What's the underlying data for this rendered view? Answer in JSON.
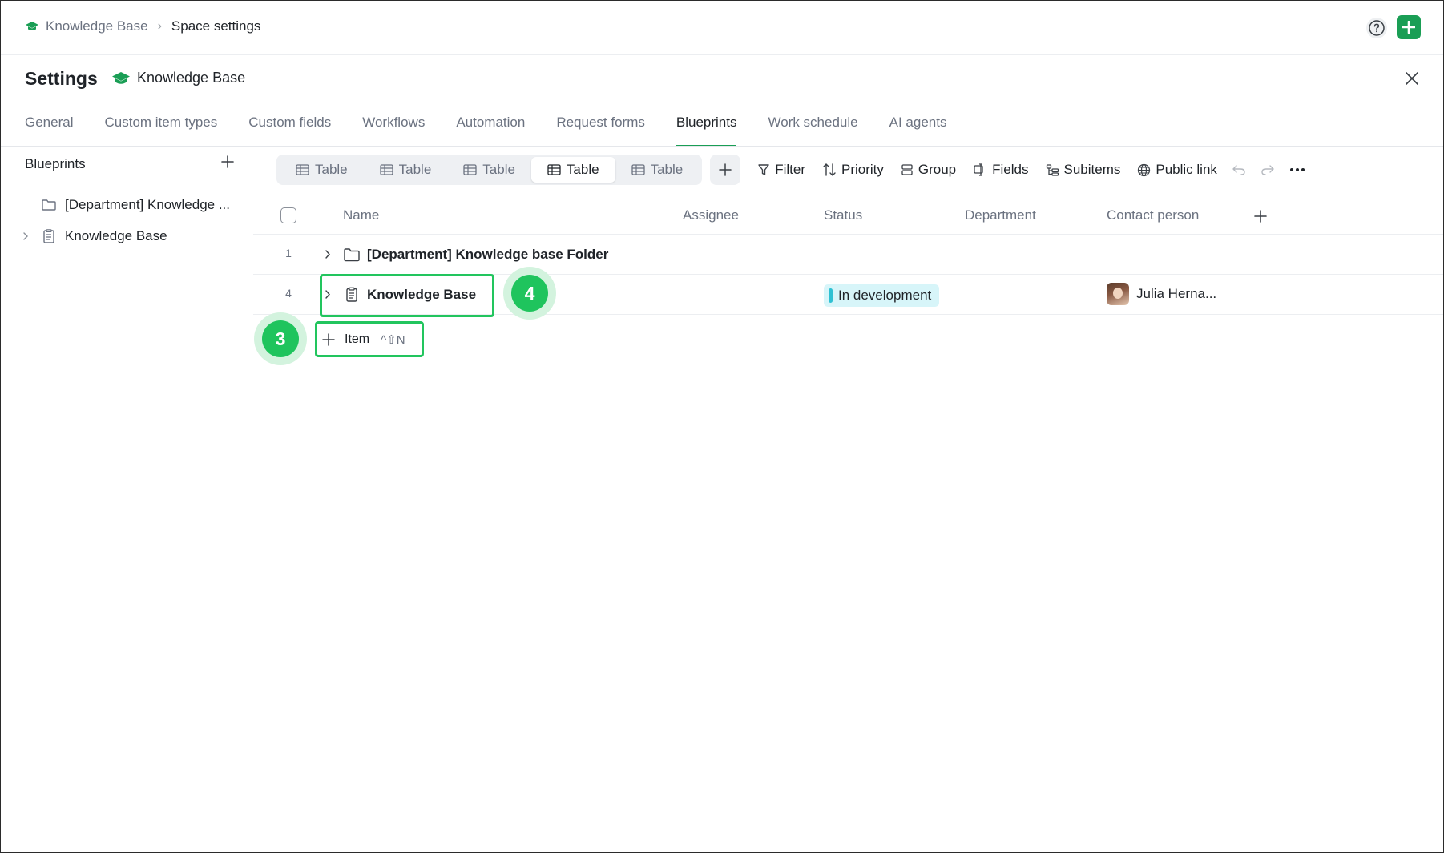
{
  "breadcrumb": {
    "space": "Knowledge Base",
    "current": "Space settings"
  },
  "header": {
    "title": "Settings",
    "space_name": "Knowledge Base"
  },
  "tabs": [
    {
      "label": "General",
      "active": false
    },
    {
      "label": "Custom item types",
      "active": false
    },
    {
      "label": "Custom fields",
      "active": false
    },
    {
      "label": "Workflows",
      "active": false
    },
    {
      "label": "Automation",
      "active": false
    },
    {
      "label": "Request forms",
      "active": false
    },
    {
      "label": "Blueprints",
      "active": true
    },
    {
      "label": "Work schedule",
      "active": false
    },
    {
      "label": "AI agents",
      "active": false
    }
  ],
  "sidebar": {
    "title": "Blueprints",
    "items": [
      {
        "label": "[Department] Knowledge ...",
        "icon": "folder-icon"
      },
      {
        "label": "Knowledge Base",
        "icon": "document-icon"
      }
    ]
  },
  "toolbar": {
    "views": [
      "Table",
      "Table",
      "Table",
      "Table",
      "Table"
    ],
    "active_view": 3,
    "filter": "Filter",
    "priority": "Priority",
    "group": "Group",
    "fields": "Fields",
    "subitems": "Subitems",
    "public_link": "Public link"
  },
  "table": {
    "columns": [
      "Name",
      "Assignee",
      "Status",
      "Department",
      "Contact person"
    ],
    "rows": [
      {
        "num": "1",
        "name": "[Department] Knowledge base Folder",
        "icon": "folder-icon",
        "status": "",
        "contact": ""
      },
      {
        "num": "4",
        "name": "Knowledge Base",
        "icon": "document-icon",
        "status": "In development",
        "contact": "Julia Herna..."
      }
    ],
    "add_item_label": "Item",
    "add_item_shortcut": "^⇧N"
  },
  "annotations": {
    "badge_3": "3",
    "badge_4": "4"
  },
  "colors": {
    "accent": "#1a9e55",
    "highlight": "#22c55e",
    "status_bg": "#d7f5f9",
    "status_bar": "#2fc1d3"
  }
}
